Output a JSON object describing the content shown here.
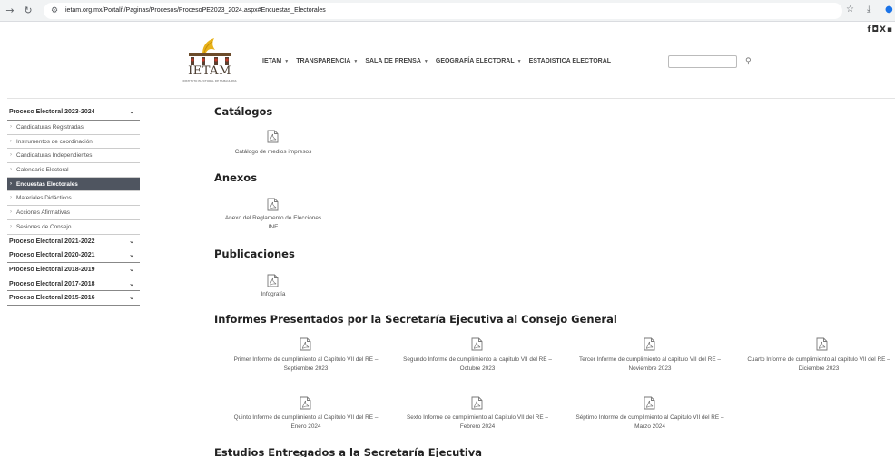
{
  "browser": {
    "url": "ietam.org.mx/Portalñ/Paginas/Procesos/ProcesoPE2023_2024.aspx#Encuestas_Electorales"
  },
  "header": {
    "logo_text": "IETAM",
    "logo_subtitle": "INSTITUTO ELECTORAL DE TAMAULIPAS",
    "nav": [
      {
        "label": "IETAM"
      },
      {
        "label": "TRANSPARENCIA"
      },
      {
        "label": "SALA DE PRENSA"
      },
      {
        "label": "GEOGRAFÍA ELECTORAL"
      },
      {
        "label": "ESTADISTICA ELECTORAL"
      }
    ],
    "search_placeholder": "",
    "social_icons": [
      "facebook-icon",
      "instagram-icon",
      "x-icon",
      "youtube-icon"
    ]
  },
  "sidebar": {
    "current_process": "Proceso Electoral 2023-2024",
    "items": [
      {
        "label": "Candidaturas Registradas"
      },
      {
        "label": "Instrumentos de coordinación"
      },
      {
        "label": "Candidaturas Independientes"
      },
      {
        "label": "Calendario Electoral"
      },
      {
        "label": "Encuestas Electorales"
      },
      {
        "label": "Materiales Didácticos"
      },
      {
        "label": "Acciones Afirmativas"
      },
      {
        "label": "Sesiones de Consejo"
      }
    ],
    "active_item": "Encuestas Electorales",
    "other_processes": [
      {
        "label": "Proceso Electoral 2021-2022"
      },
      {
        "label": "Proceso Electoral 2020-2021"
      },
      {
        "label": "Proceso Electoral 2018-2019"
      },
      {
        "label": "Proceso Electoral 2017-2018"
      },
      {
        "label": "Proceso Electoral 2015-2016"
      }
    ]
  },
  "main": {
    "catalogos": {
      "title": "Catálogos",
      "docs": [
        {
          "label": "Catálogo de medios impresos"
        }
      ]
    },
    "anexos": {
      "title": "Anexos",
      "docs": [
        {
          "label": "Anexo del Reglamento de Elecciones INE"
        }
      ]
    },
    "publicaciones": {
      "title": "Publicaciones",
      "docs": [
        {
          "label": "Infografía"
        }
      ]
    },
    "informes": {
      "title": "Informes Presentados por la Secretaría Ejecutiva al Consejo General",
      "docs": [
        {
          "label": "Primer Informe de cumplimiento al Capítulo VII del RE – Septiembre 2023"
        },
        {
          "label": "Segundo Informe de cumplimiento al capitulo VII del RE – Octubre 2023"
        },
        {
          "label": "Tercer Informe de cumplimiento al capitulo VII del RE – Noviembre 2023"
        },
        {
          "label": "Cuarto Informe de cumplimiento al capitulo VII del RE – Diciembre 2023"
        },
        {
          "label": "Quinto Informe de cumplimiento al Capítulo VII del RE – Enero 2024"
        },
        {
          "label": "Sexto Informe de cumplimiento al Capitulo VII del RE – Febrero 2024"
        },
        {
          "label": "Séptimo Informe de cumplimiento al Capitulo VII del RE – Marzo 2024"
        }
      ]
    },
    "estudios": {
      "title": "Estudios Entregados a la Secretaría Ejecutiva"
    }
  }
}
